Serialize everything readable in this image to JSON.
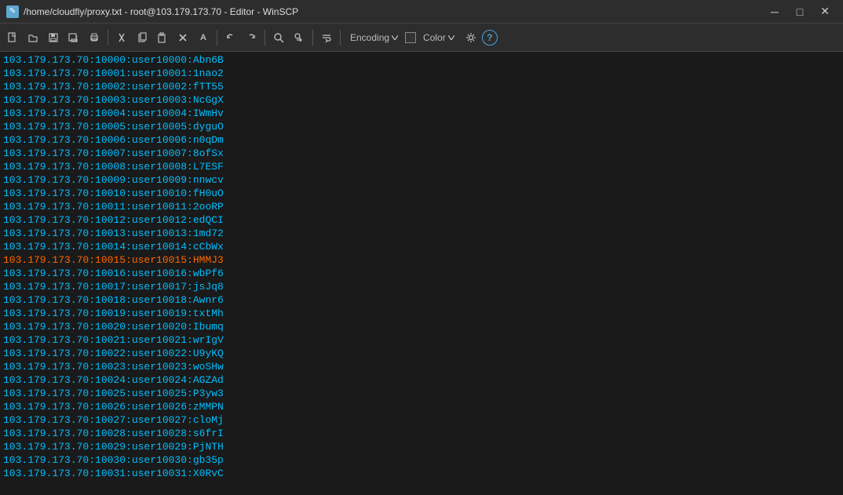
{
  "titleBar": {
    "icon": "✎",
    "title": "/home/cloudfly/proxy.txt - root@103.179.173.70 - Editor - WinSCP",
    "minimize": "─",
    "maximize": "□",
    "close": "✕"
  },
  "toolbar": {
    "buttons": [
      {
        "name": "new",
        "icon": "📄"
      },
      {
        "name": "open",
        "icon": "📂"
      },
      {
        "name": "save",
        "icon": "💾"
      },
      {
        "name": "saveas",
        "icon": "📋"
      },
      {
        "name": "print",
        "icon": "🖨"
      },
      {
        "name": "sep1",
        "icon": ""
      },
      {
        "name": "cut",
        "icon": "✂"
      },
      {
        "name": "copy",
        "icon": "📋"
      },
      {
        "name": "paste",
        "icon": "📌"
      },
      {
        "name": "delete",
        "icon": "✕"
      },
      {
        "name": "rename",
        "icon": "A"
      },
      {
        "name": "sep2",
        "icon": ""
      },
      {
        "name": "undo",
        "icon": "↩"
      },
      {
        "name": "redo",
        "icon": "↪"
      },
      {
        "name": "sep3",
        "icon": ""
      },
      {
        "name": "find",
        "icon": "🔍"
      },
      {
        "name": "findreplace",
        "icon": "⇄"
      },
      {
        "name": "sep4",
        "icon": ""
      },
      {
        "name": "wrap",
        "icon": "⏎"
      }
    ],
    "encoding_label": "Encoding",
    "color_label": "Color",
    "help_icon": "?"
  },
  "editor": {
    "lines": [
      "103.179.173.70:10000:user10000:Abn6B",
      "103.179.173.70:10001:user10001:1nao2",
      "103.179.173.70:10002:user10002:fTT55",
      "103.179.173.70:10003:user10003:NcGgX",
      "103.179.173.70:10004:user10004:IWmHv",
      "103.179.173.70:10005:user10005:dyguO",
      "103.179.173.70:10006:user10006:n0qDm",
      "103.179.173.70:10007:user10007:8ofSx",
      "103.179.173.70:10008:user10008:L7ESF",
      "103.179.173.70:10009:user10009:nnwcv",
      "103.179.173.70:10010:user10010:fH0uO",
      "103.179.173.70:10011:user10011:2ooRP",
      "103.179.173.70:10012:user10012:edQCI",
      "103.179.173.70:10013:user10013:1md72",
      "103.179.173.70:10014:user10014:cCbWx",
      "103.179.173.70:10015:user10015:HMMJ3",
      "103.179.173.70:10016:user10016:wbPf6",
      "103.179.173.70:10017:user10017:jsJq8",
      "103.179.173.70:10018:user10018:Awnr6",
      "103.179.173.70:10019:user10019:txtMh",
      "103.179.173.70:10020:user10020:Ibumq",
      "103.179.173.70:10021:user10021:wrIgV",
      "103.179.173.70:10022:user10022:U9yKQ",
      "103.179.173.70:10023:user10023:woSHw",
      "103.179.173.70:10024:user10024:AGZAd",
      "103.179.173.70:10025:user10025:P3yw3",
      "103.179.173.70:10026:user10026:zMMPN",
      "103.179.173.70:10027:user10027:cloMj",
      "103.179.173.70:10028:user10028:s6frI",
      "103.179.173.70:10029:user10029:PjNTH",
      "103.179.173.70:10030:user10030:gb35p",
      "103.179.173.70:10031:user10031:X0RvC"
    ],
    "highlighted_line": 15
  }
}
